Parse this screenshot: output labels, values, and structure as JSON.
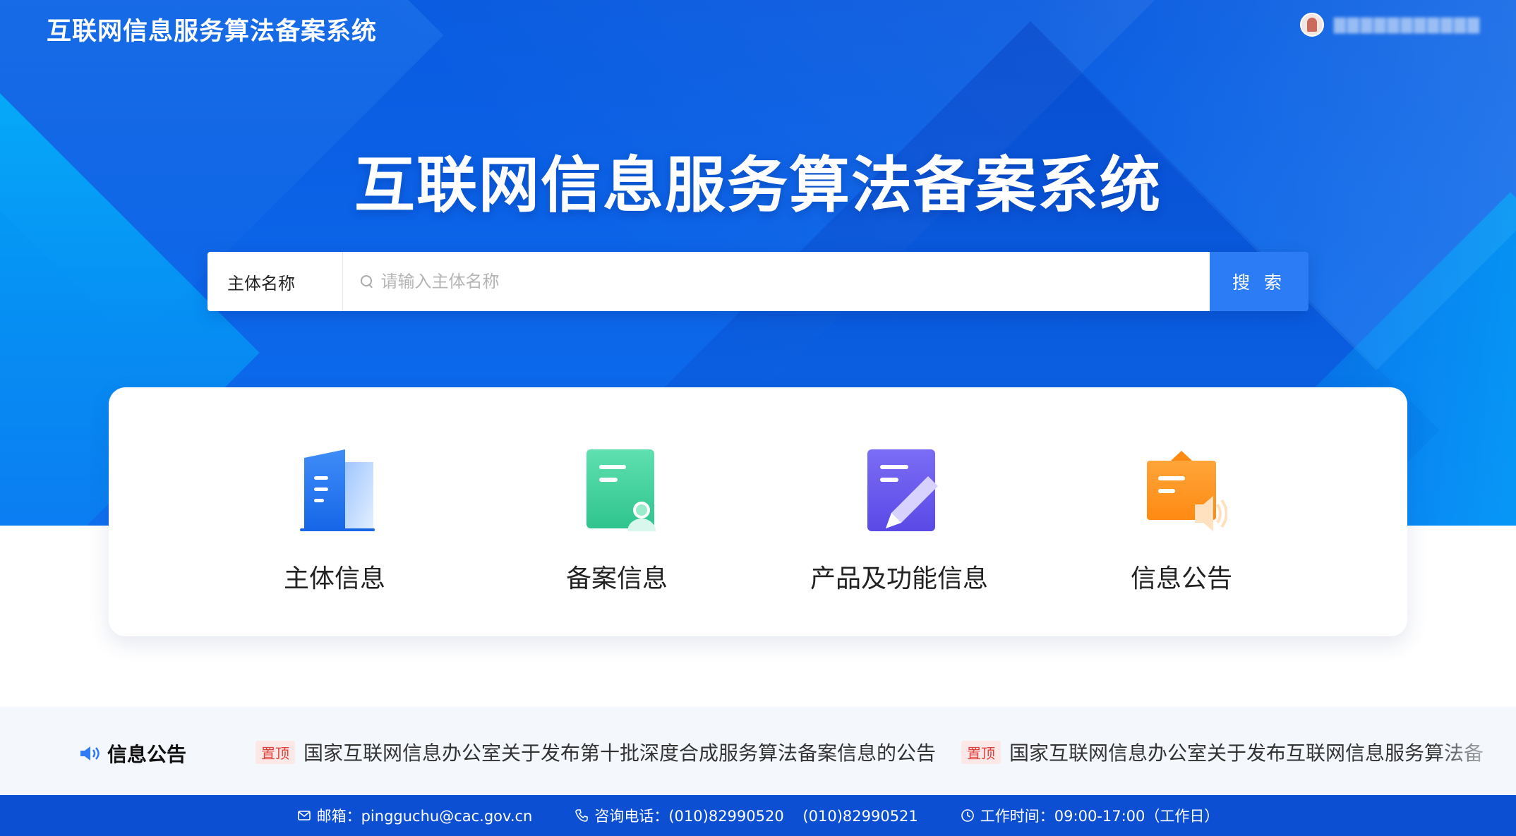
{
  "header": {
    "title": "互联网信息服务算法备案系统",
    "user_name": "▇▇▇▇▇▇▇▇▇▇▇"
  },
  "hero": {
    "title": "互联网信息服务算法备案系统"
  },
  "search": {
    "type_label": "主体名称",
    "placeholder": "请输入主体名称",
    "button_label": "搜 索"
  },
  "categories": [
    {
      "label": "主体信息",
      "icon": "building-icon"
    },
    {
      "label": "备案信息",
      "icon": "record-user-icon"
    },
    {
      "label": "产品及功能信息",
      "icon": "document-edit-icon"
    },
    {
      "label": "信息公告",
      "icon": "announcement-icon"
    }
  ],
  "notice": {
    "title": "信息公告",
    "items": [
      {
        "tag": "置顶",
        "text": "国家互联网信息办公室关于发布第十批深度合成服务算法备案信息的公告"
      },
      {
        "tag": "置顶",
        "text": "国家互联网信息办公室关于发布互联网信息服务算法备案信息的公告"
      }
    ]
  },
  "footer": {
    "email": "邮箱：pingguchu@cac.gov.cn",
    "phone": "咨询电话：(010)82990520    (010)82990521",
    "hours": "工作时间：09:00-17:00（工作日）"
  },
  "colors": {
    "hero_blue": "#0b63e6",
    "accent_button": "#2c7cf6",
    "footer_blue": "#0c4fd3",
    "pin_red": "#e2403a"
  }
}
